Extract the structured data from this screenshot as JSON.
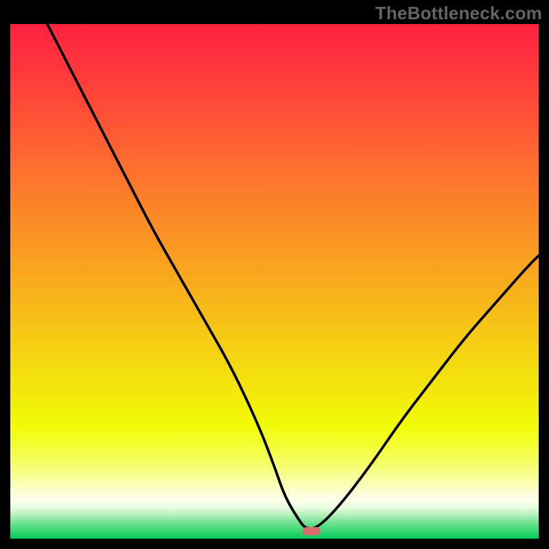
{
  "attribution": "TheBottleneck.com",
  "colors": {
    "frame": "#000000",
    "curve": "#000000",
    "marker": "#d86b6e",
    "attribution_text": "#646464",
    "gradient_stops": [
      {
        "offset": 0.0,
        "color": "#fe2241"
      },
      {
        "offset": 0.1,
        "color": "#fe3a3b"
      },
      {
        "offset": 0.22,
        "color": "#fd5d33"
      },
      {
        "offset": 0.35,
        "color": "#fb8328"
      },
      {
        "offset": 0.48,
        "color": "#f9a61e"
      },
      {
        "offset": 0.6,
        "color": "#f6c815"
      },
      {
        "offset": 0.72,
        "color": "#f3ea0b"
      },
      {
        "offset": 0.78,
        "color": "#f1fb07"
      },
      {
        "offset": 0.82,
        "color": "#f3fe34"
      },
      {
        "offset": 0.86,
        "color": "#f6fe73"
      },
      {
        "offset": 0.9,
        "color": "#fafec0"
      },
      {
        "offset": 0.925,
        "color": "#fdfeed"
      },
      {
        "offset": 0.94,
        "color": "#e7fde0"
      },
      {
        "offset": 0.955,
        "color": "#afefb7"
      },
      {
        "offset": 0.97,
        "color": "#6ce190"
      },
      {
        "offset": 0.99,
        "color": "#27d46c"
      },
      {
        "offset": 1.0,
        "color": "#00cc57"
      }
    ]
  },
  "chart_data": {
    "type": "line",
    "title": "",
    "xlabel": "",
    "ylabel": "",
    "xlim": [
      0,
      100
    ],
    "ylim": [
      0,
      100
    ],
    "grid": false,
    "legend": false,
    "series": [
      {
        "name": "bottleneck-curve",
        "x": [
          7,
          12,
          17,
          22,
          27,
          32,
          37,
          42,
          47,
          50,
          52,
          55,
          56,
          58,
          62,
          68,
          74,
          80,
          86,
          92,
          98,
          100
        ],
        "y": [
          100,
          90,
          80,
          70,
          60,
          51,
          42,
          33,
          22,
          14,
          8,
          3,
          2,
          2,
          6,
          14,
          23,
          31,
          39,
          46,
          53,
          55
        ]
      }
    ],
    "annotations": [
      {
        "name": "min-marker",
        "x": 57,
        "y": 1.5
      }
    ]
  }
}
